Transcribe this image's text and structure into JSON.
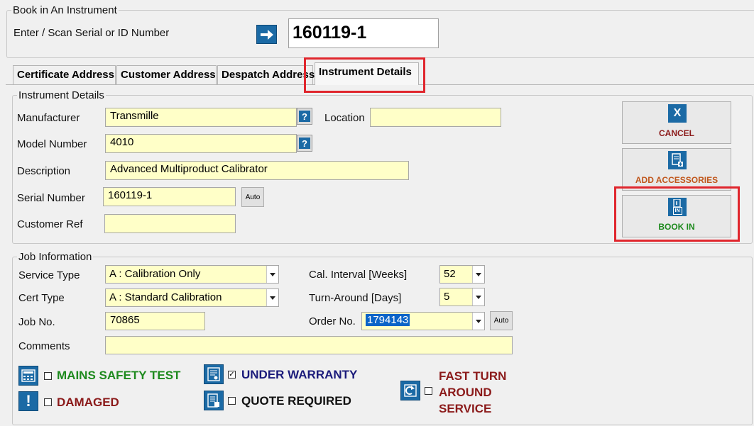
{
  "book_in": {
    "legend": "Book in An Instrument",
    "scan_label": "Enter / Scan Serial or ID Number",
    "scan_value": "160119-1"
  },
  "tabs": [
    {
      "label": "Certificate Address"
    },
    {
      "label": "Customer Address"
    },
    {
      "label": "Despatch Address"
    },
    {
      "label": "Instrument Details"
    }
  ],
  "instrument": {
    "legend": "Instrument Details",
    "manufacturer_label": "Manufacturer",
    "manufacturer_value": "Transmille",
    "model_label": "Model Number",
    "model_value": "4010",
    "description_label": "Description",
    "description_value": "Advanced Multiproduct Calibrator",
    "serial_label": "Serial Number",
    "serial_value": "160119-1",
    "serial_auto": "Auto",
    "customer_ref_label": "Customer Ref",
    "customer_ref_value": "",
    "location_label": "Location",
    "location_value": "",
    "help_glyph": "?"
  },
  "actions": {
    "cancel": {
      "label": "CANCEL",
      "icon": "x-icon",
      "glyph": "X",
      "color": "#8b1a1a"
    },
    "add_accessories": {
      "label": "ADD ACCESSORIES",
      "icon": "document-add-icon",
      "color": "#c0561b"
    },
    "book_in": {
      "label": "BOOK IN",
      "icon": "book-in-icon",
      "glyph": "IN",
      "color": "#1e8a1e"
    }
  },
  "job": {
    "legend": "Job Information",
    "service_type_label": "Service Type",
    "service_type_value": "A : Calibration Only",
    "cert_type_label": "Cert Type",
    "cert_type_value": "A : Standard Calibration",
    "job_no_label": "Job No.",
    "job_no_value": "70865",
    "comments_label": "Comments",
    "comments_value": "",
    "cal_interval_label": "Cal. Interval [Weeks]",
    "cal_interval_value": "52",
    "turnaround_label": "Turn-Around [Days]",
    "turnaround_value": "5",
    "order_no_label": "Order No.",
    "order_no_value": "1794143",
    "order_auto": "Auto"
  },
  "flags": {
    "mains_safety": {
      "label": "MAINS SAFETY TEST",
      "checked": false,
      "color": "#1e8a1e",
      "icon": "calculator-icon"
    },
    "damaged": {
      "label": "DAMAGED",
      "checked": false,
      "color": "#8b1a1a",
      "icon": "exclamation-icon",
      "glyph": "!"
    },
    "under_warranty": {
      "label": "UNDER WARRANTY",
      "checked": true,
      "check_glyph": "✓",
      "color": "#1a1a7a",
      "icon": "certificate-icon"
    },
    "quote_required": {
      "label": "QUOTE REQUIRED",
      "checked": false,
      "color": "#111111",
      "icon": "quote-document-icon"
    },
    "fast_turnaround": {
      "line1": "FAST TURN",
      "line2": "AROUND",
      "line3": "SERVICE",
      "checked": false,
      "color": "#8b1a1a",
      "icon": "fast-return-icon"
    }
  },
  "colors": {
    "field_bg": "#ffffc8",
    "accent_blue": "#1b6aa5",
    "highlight_red": "#e0262d"
  }
}
